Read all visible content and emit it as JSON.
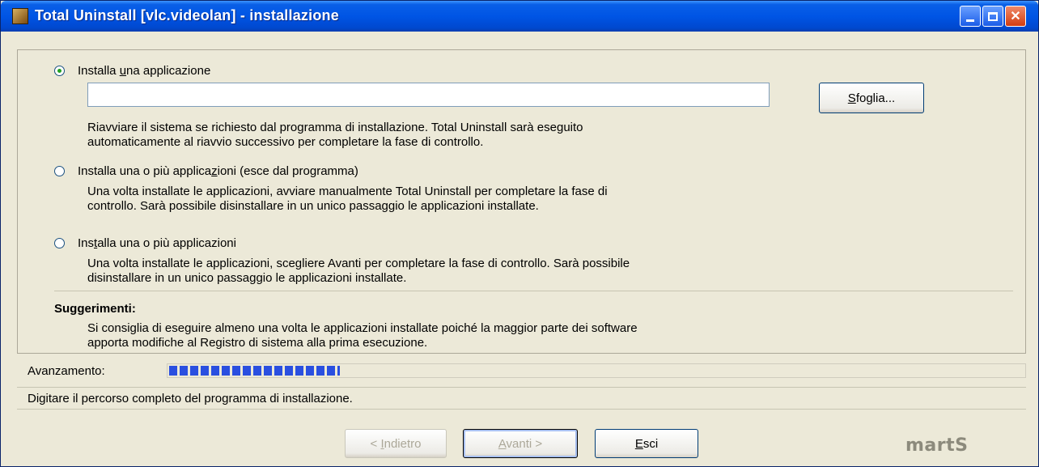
{
  "window": {
    "title": "Total Uninstall [vlc.videolan] - installazione"
  },
  "options": [
    {
      "label_pre": "Installa ",
      "label_u": "u",
      "label_post": "na applicazione",
      "checked": true,
      "description_lines": [
        "Riavviare il sistema se richiesto dal programma di installazione. Total Uninstall sarà eseguito",
        "automaticamente al riavvio successivo per completare la fase di controllo."
      ]
    },
    {
      "label_pre": "Installa una o più applica",
      "label_u": "z",
      "label_post": "ioni (esce dal programma)",
      "checked": false,
      "description_lines": [
        "Una volta installate le applicazioni, avviare manualmente Total Uninstall per completare la fase di",
        "controllo. Sarà possibile disinstallare in un unico passaggio le applicazioni installate."
      ]
    },
    {
      "label_pre": "Ins",
      "label_u": "t",
      "label_post": "alla una o più applicazioni",
      "checked": false,
      "description_lines": [
        "Una volta installate le applicazioni, scegliere Avanti per completare la fase di controllo. Sarà possibile",
        "disinstallare in un unico passaggio le applicazioni installate."
      ]
    }
  ],
  "path_input": {
    "value": ""
  },
  "browse_button": {
    "label_u": "S",
    "label_post": "foglia..."
  },
  "tips": {
    "title": "Suggerimenti:",
    "lines": [
      "Si consiglia di eseguire almeno una volta le applicazioni installate poiché la maggior parte dei software",
      "apporta modifiche al Registro di sistema alla prima esecuzione."
    ]
  },
  "progress": {
    "label": "Avanzamento:",
    "fraction": 0.2
  },
  "status_text": "Digitare il percorso completo del programma di installazione.",
  "buttons": {
    "back": {
      "pre": "< ",
      "u": "I",
      "post": "ndietro",
      "enabled": false
    },
    "next": {
      "u": "A",
      "post": "vanti >",
      "enabled": false
    },
    "exit": {
      "u": "E",
      "post": "sci",
      "enabled": true
    }
  },
  "brand": "martS",
  "colors": {
    "titlebar": "#0055e5",
    "dialog_bg": "#ece9d8",
    "progress": "#2a4fe0",
    "radio_dot": "#21a121"
  }
}
